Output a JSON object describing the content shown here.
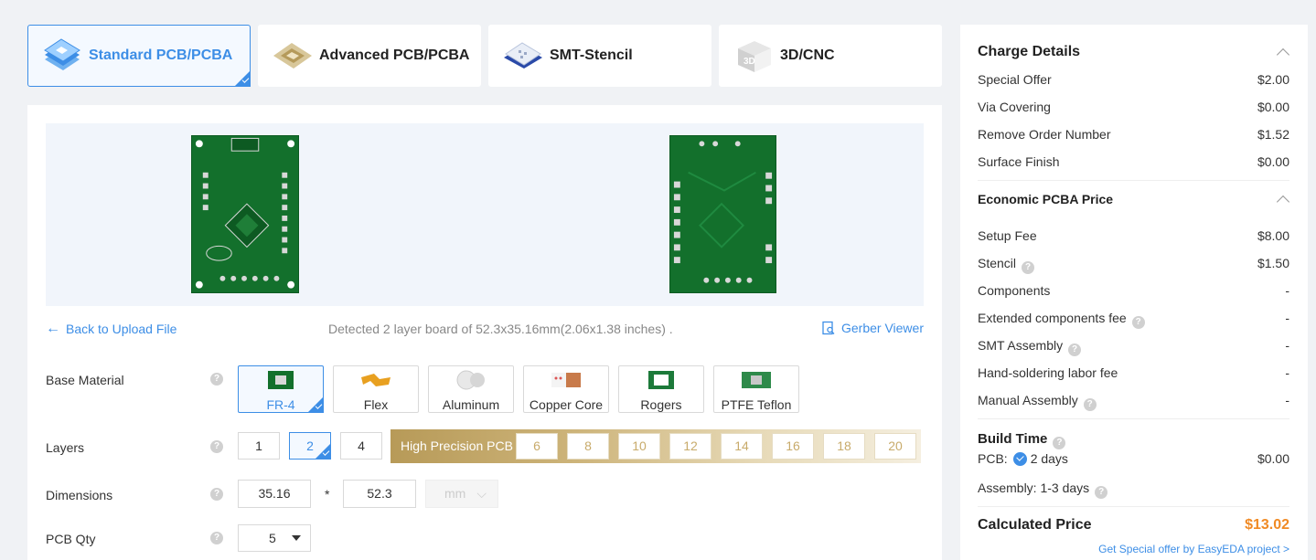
{
  "tabs": [
    {
      "label": "Standard PCB/PCBA",
      "icon": "pcb-stack-icon",
      "active": true
    },
    {
      "label": "Advanced PCB/PCBA",
      "icon": "chip-gold-icon",
      "active": false
    },
    {
      "label": "SMT-Stencil",
      "icon": "stencil-icon",
      "active": false
    },
    {
      "label": "3D/CNC",
      "icon": "cube-3d-icon",
      "active": false
    }
  ],
  "preview": {
    "back_link": "Back to Upload File",
    "detected": "Detected 2 layer board of 52.3x35.16mm(2.06x1.38 inches) .",
    "gerber_viewer": "Gerber Viewer"
  },
  "options": {
    "base_material": {
      "label": "Base Material",
      "choices": [
        "FR-4",
        "Flex",
        "Aluminum",
        "Copper Core",
        "Rogers",
        "PTFE Teflon"
      ],
      "selected": "FR-4"
    },
    "layers": {
      "label": "Layers",
      "choices": [
        "1",
        "2",
        "4"
      ],
      "selected": "2",
      "high_precision_label": "High Precision PCB",
      "high_precision_choices": [
        "6",
        "8",
        "10",
        "12",
        "14",
        "16",
        "18",
        "20"
      ]
    },
    "dimensions": {
      "label": "Dimensions",
      "width": "35.16",
      "times": "*",
      "height": "52.3",
      "unit": "mm"
    },
    "pcb_qty": {
      "label": "PCB Qty",
      "value": "5"
    }
  },
  "sidebar": {
    "charge_details": {
      "title": "Charge Details",
      "rows": [
        {
          "label": "Special Offer",
          "value": "$2.00"
        },
        {
          "label": "Via Covering",
          "value": "$0.00"
        },
        {
          "label": "Remove Order Number",
          "value": "$1.52"
        },
        {
          "label": "Surface Finish",
          "value": "$0.00"
        }
      ]
    },
    "pcba_price": {
      "title": "Economic PCBA Price",
      "rows": [
        {
          "label": "Setup Fee",
          "value": "$8.00"
        },
        {
          "label": "Stencil",
          "value": "$1.50"
        },
        {
          "label": "Components",
          "value": "-"
        },
        {
          "label": "Extended components fee",
          "value": "-"
        },
        {
          "label": "SMT Assembly",
          "value": "-"
        },
        {
          "label": "Hand-soldering labor fee",
          "value": "-"
        },
        {
          "label": "Manual Assembly",
          "value": "-"
        }
      ]
    },
    "build_time": {
      "title": "Build Time",
      "pcb_label": "PCB:",
      "pcb_days": "2 days",
      "pcb_price": "$0.00",
      "assembly_label": "Assembly:",
      "assembly_days": "1-3 days"
    },
    "calculated": {
      "label": "Calculated Price",
      "value": "$13.02",
      "special_link": "Get Special offer by EasyEDA project >"
    }
  },
  "colors": {
    "accent": "#3d8ee6",
    "price": "#f08a24",
    "gold": "#c8ab6b"
  }
}
